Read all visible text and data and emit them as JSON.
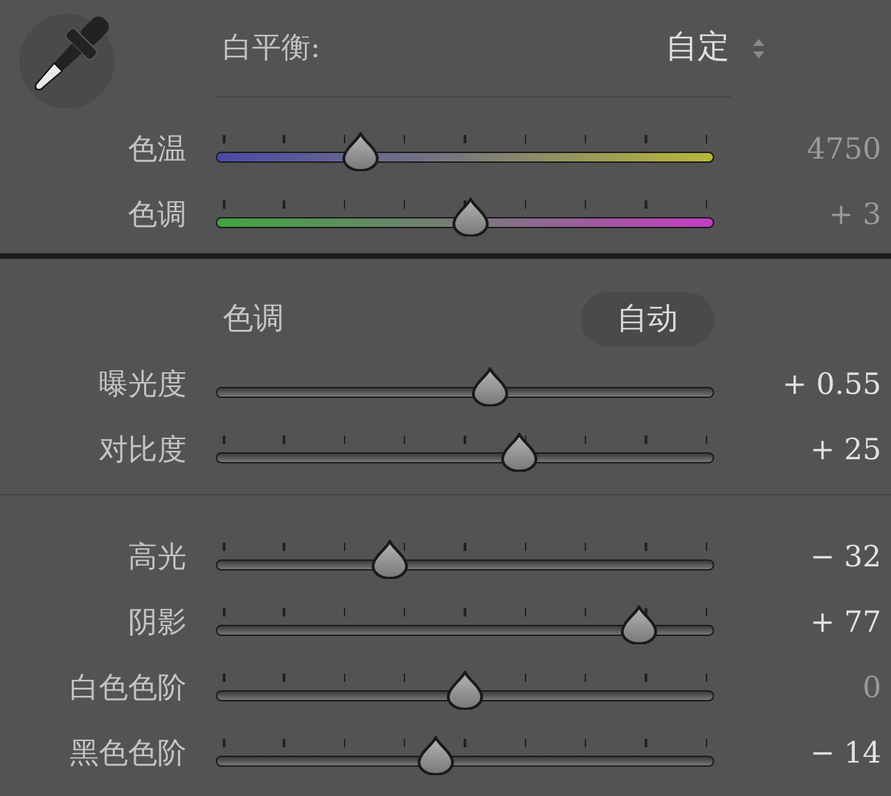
{
  "white_balance": {
    "label": "白平衡:",
    "value": "自定",
    "sliders": [
      {
        "label": "色温",
        "kind": "temp",
        "ticks": true,
        "level": 0.29,
        "reading": "4750",
        "dimmed": true
      },
      {
        "label": "色调",
        "kind": "tint",
        "ticks": true,
        "level": 0.51,
        "reading": "+ 3",
        "dimmed": true
      }
    ]
  },
  "tone": {
    "title": "色调",
    "auto_button": "自动",
    "sliders": [
      {
        "label": "曝光度",
        "kind": "plain",
        "ticks": false,
        "level": 0.55,
        "reading": "+ 0.55",
        "dimmed": false
      },
      {
        "label": "对比度",
        "kind": "plain",
        "ticks": true,
        "level": 0.61,
        "reading": "+ 25",
        "dimmed": false
      }
    ]
  },
  "presence": {
    "sliders": [
      {
        "label": "高光",
        "kind": "plain",
        "ticks": true,
        "level": 0.35,
        "reading": "− 32",
        "dimmed": false
      },
      {
        "label": "阴影",
        "kind": "plain",
        "ticks": true,
        "level": 0.85,
        "reading": "+ 77",
        "dimmed": false
      },
      {
        "label": "白色色阶",
        "kind": "plain",
        "ticks": true,
        "level": 0.5,
        "reading": "0",
        "dimmed": true
      },
      {
        "label": "黑色色阶",
        "kind": "plain",
        "ticks": true,
        "level": 0.44,
        "reading": "− 14",
        "dimmed": false
      }
    ]
  }
}
